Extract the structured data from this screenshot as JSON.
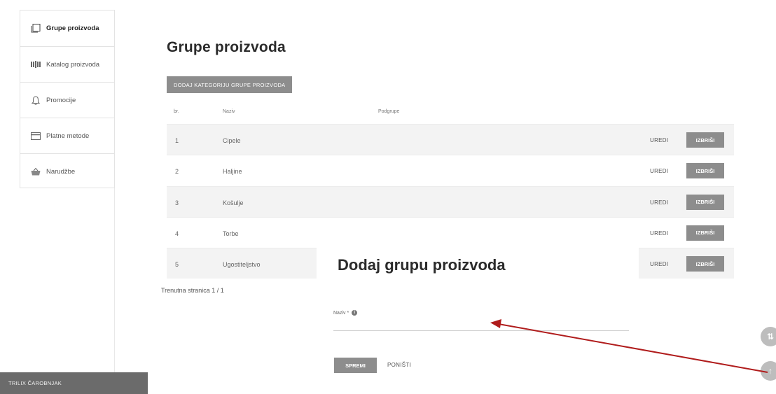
{
  "sidebar": {
    "items": [
      {
        "label": "Grupe proizvoda",
        "icon": "square-outline-icon"
      },
      {
        "label": "Katalog proizvoda",
        "icon": "catalog-bars-icon"
      },
      {
        "label": "Promocije",
        "icon": "bell-icon"
      },
      {
        "label": "Platne metode",
        "icon": "credit-card-icon"
      },
      {
        "label": "Narudžbe",
        "icon": "basket-icon"
      }
    ]
  },
  "main": {
    "title": "Grupe proizvoda",
    "add_button": "DODAJ KATEGORIJU GRUPE PROIZVODA",
    "columns": [
      "br.",
      "Naziv",
      "Podgrupe"
    ],
    "rows": [
      {
        "num": "1",
        "name": "Cipele",
        "edit": "UREDI",
        "delete": "IZBRIŠI"
      },
      {
        "num": "2",
        "name": "Haljine",
        "edit": "UREDI",
        "delete": "IZBRIŠI"
      },
      {
        "num": "3",
        "name": "Košulje",
        "edit": "UREDI",
        "delete": "IZBRIŠI"
      },
      {
        "num": "4",
        "name": "Torbe",
        "edit": "UREDI",
        "delete": "IZBRIŠI"
      },
      {
        "num": "5",
        "name": "Ugostiteljstvo",
        "edit": "UREDI",
        "delete": "IZBRIŠI"
      }
    ],
    "pager": "Trenutna stranica 1 / 1"
  },
  "modal": {
    "title": "Dodaj grupu proizvoda",
    "field_label": "Naziv *",
    "field_value": "",
    "save": "SPREMI",
    "cancel": "PONIŠTI"
  },
  "wizard": {
    "label": "TRILIX ČAROBNJAK"
  },
  "fab": {
    "top_glyph": "⇅",
    "bottom_glyph": "↑"
  },
  "colors": {
    "button_gray": "#8d8d8d",
    "annotation_arrow": "#b01c1c",
    "wizard_bar": "#6b6b6b"
  }
}
